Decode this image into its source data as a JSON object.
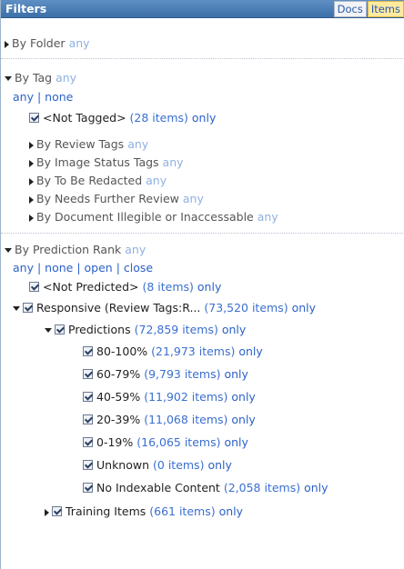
{
  "header": {
    "title": "Filters",
    "tabs": [
      "Docs",
      "Items"
    ]
  },
  "folder": {
    "label": "By Folder",
    "any": "any"
  },
  "tag": {
    "label": "By Tag",
    "any": "any",
    "links": [
      "any",
      "none"
    ],
    "not_tagged": {
      "label": "<Not Tagged>",
      "count": "(28 items)",
      "only": "only"
    },
    "subs": [
      {
        "label": "By Review Tags",
        "any": "any"
      },
      {
        "label": "By Image Status Tags",
        "any": "any"
      },
      {
        "label": "By To Be Redacted",
        "any": "any"
      },
      {
        "label": "By Needs Further Review",
        "any": "any"
      },
      {
        "label": "By Document Illegible or Inaccessable",
        "any": "any"
      }
    ]
  },
  "prediction": {
    "label": "By Prediction Rank",
    "any": "any",
    "links": [
      "any",
      "none",
      "open",
      "close"
    ],
    "not_predicted": {
      "label": "<Not Predicted>",
      "count": "(8 items)",
      "only": "only"
    },
    "responsive": {
      "label": "Responsive (Review Tags:R...",
      "count": "(73,520 items)",
      "only": "only"
    },
    "predictions": {
      "label": "Predictions",
      "count": "(72,859 items)",
      "only": "only"
    },
    "ranges": [
      {
        "label": "80-100%",
        "count": "(21,973 items)",
        "only": "only"
      },
      {
        "label": "60-79%",
        "count": "(9,793 items)",
        "only": "only"
      },
      {
        "label": "40-59%",
        "count": "(11,902 items)",
        "only": "only"
      },
      {
        "label": "20-39%",
        "count": "(11,068 items)",
        "only": "only"
      },
      {
        "label": "0-19%",
        "count": "(16,065 items)",
        "only": "only"
      },
      {
        "label": "Unknown",
        "count": "(0 items)",
        "only": "only"
      },
      {
        "label": "No Indexable Content",
        "count": "(2,058 items)",
        "only": "only"
      }
    ],
    "training": {
      "label": "Training Items",
      "count": "(661 items)",
      "only": "only"
    }
  }
}
